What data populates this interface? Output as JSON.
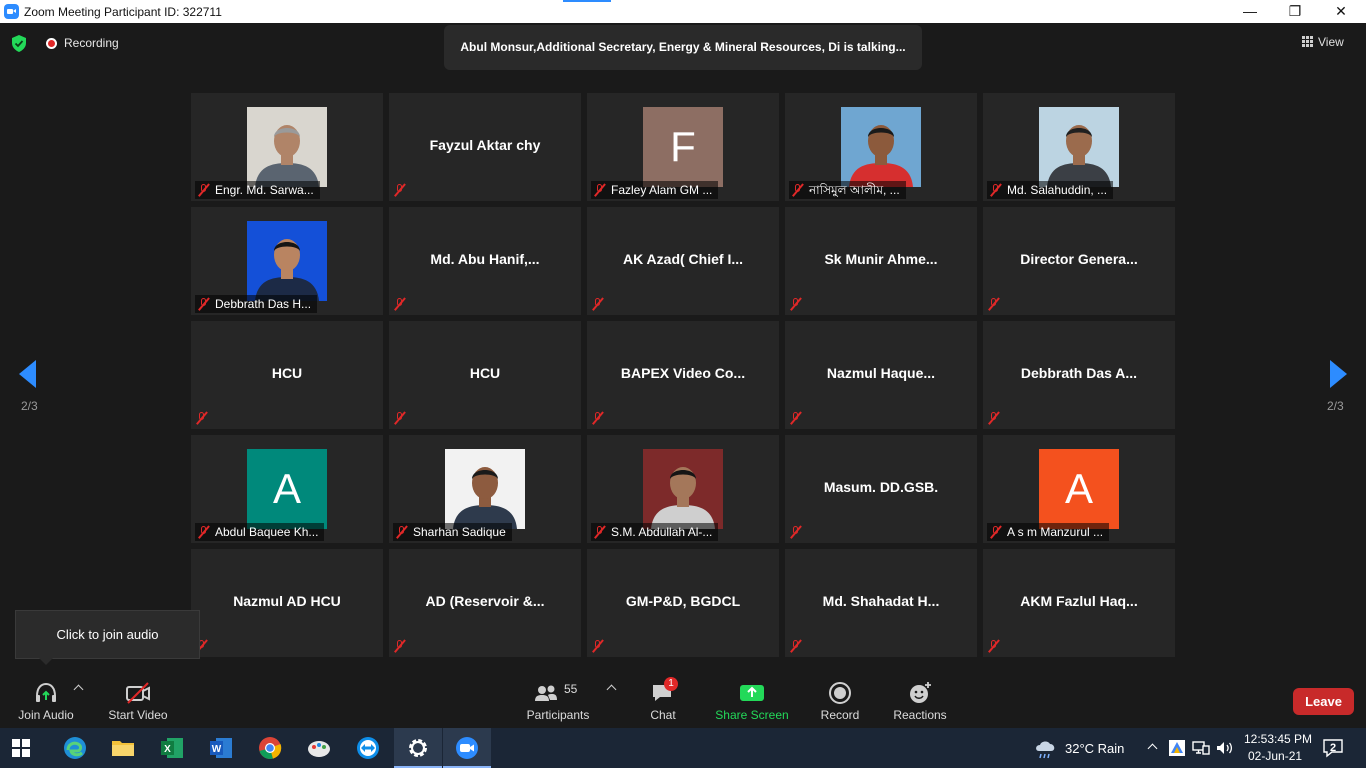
{
  "window": {
    "title": "Zoom Meeting Participant ID: 322711",
    "minimize_glyph": "—",
    "maximize_glyph": "❐",
    "close_glyph": "✕"
  },
  "topbar": {
    "recording_label": "Recording",
    "talking_text": "Abul Monsur,Additional Secretary, Energy & Mineral Resources, Di is talking...",
    "view_label": "View"
  },
  "pager": {
    "left_label": "2/3",
    "right_label": "2/3"
  },
  "tiles": [
    {
      "name": "Engr. Md. Sarwa...",
      "type": "photo",
      "photo": "man-white-wall"
    },
    {
      "name": "Fayzul Aktar chy",
      "type": "text"
    },
    {
      "name": "Fazley Alam GM ...",
      "type": "letter",
      "letter": "F",
      "color": "#8d6e63"
    },
    {
      "name": "নাসিমুল আলীম, ...",
      "type": "photo",
      "photo": "man-red-shirt"
    },
    {
      "name": "Md. Salahuddin, ...",
      "type": "photo",
      "photo": "man-window"
    },
    {
      "name": "Debbrath Das H...",
      "type": "photo",
      "photo": "man-blue-bg"
    },
    {
      "name": "Md. Abu Hanif,...",
      "type": "text"
    },
    {
      "name": "AK Azad( Chief I...",
      "type": "text"
    },
    {
      "name": "Sk Munir Ahme...",
      "type": "text"
    },
    {
      "name": "Director Genera...",
      "type": "text"
    },
    {
      "name": "HCU",
      "type": "text"
    },
    {
      "name": "HCU",
      "type": "text"
    },
    {
      "name": "BAPEX Video Co...",
      "type": "text"
    },
    {
      "name": "Nazmul Haque...",
      "type": "text"
    },
    {
      "name": "Debbrath Das A...",
      "type": "text"
    },
    {
      "name": "Abdul Baquee Kh...",
      "type": "letter",
      "letter": "A",
      "color": "#00897b"
    },
    {
      "name": "Sharhan Sadique",
      "type": "photo",
      "photo": "man-white-bg"
    },
    {
      "name": "S.M. Abdullah Al-...",
      "type": "photo",
      "photo": "man-beard"
    },
    {
      "name": "Masum. DD.GSB.",
      "type": "text"
    },
    {
      "name": "A s m Manzurul ...",
      "type": "letter",
      "letter": "A",
      "color": "#f4511e"
    },
    {
      "name": "Nazmul AD HCU",
      "type": "text"
    },
    {
      "name": "AD (Reservoir &...",
      "type": "text"
    },
    {
      "name": "GM-P&D, BGDCL",
      "type": "text"
    },
    {
      "name": "Md. Shahadat H...",
      "type": "text"
    },
    {
      "name": "AKM Fazlul Haq...",
      "type": "text"
    }
  ],
  "tooltip": {
    "text": "Click to join audio"
  },
  "toolbar": {
    "join_audio": "Join Audio",
    "start_video": "Start Video",
    "participants": "Participants",
    "participants_count": "55",
    "chat": "Chat",
    "chat_badge": "1",
    "share_screen": "Share Screen",
    "record": "Record",
    "reactions": "Reactions",
    "leave": "Leave"
  },
  "colors": {
    "accent_blue": "#2d8cff",
    "share_green": "#23d959",
    "leave_red": "#c82a2a",
    "mute_red": "#e02828"
  },
  "taskbar": {
    "apps": [
      "windows-start",
      "edge",
      "file-explorer",
      "excel",
      "word",
      "chrome",
      "paint",
      "teamviewer",
      "settings",
      "zoom"
    ],
    "weather": "32°C  Rain",
    "time": "12:53:45 PM",
    "date": "02-Jun-21",
    "notifications": "2"
  }
}
